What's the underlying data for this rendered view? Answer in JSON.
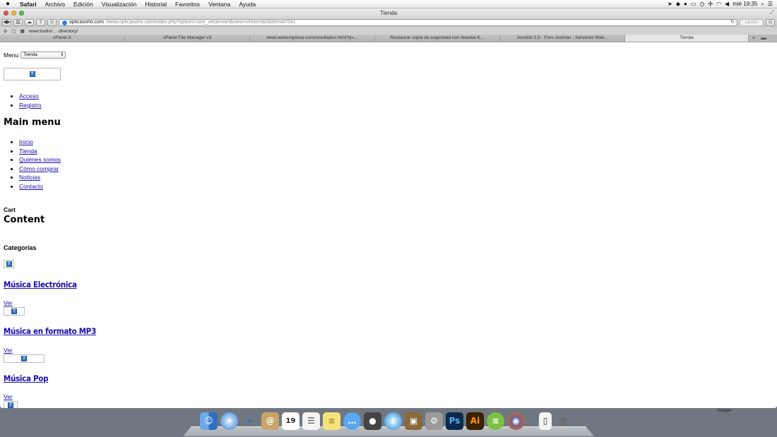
{
  "menubar": {
    "apple": "",
    "app": "Safari",
    "items": [
      "Archivo",
      "Edición",
      "Visualización",
      "Historial",
      "Favoritos",
      "Ventana",
      "Ayuda"
    ],
    "clock": "mié 19:35"
  },
  "window": {
    "title": "Tienda"
  },
  "toolbar": {
    "url_host": "opticasoho.com",
    "url_path": "/www.opticasoho.com/index.php?option=com_virtuemart&view=virtuemart&Itemid=541",
    "reader": "Lector"
  },
  "bookmarks": {
    "item1": "www.tooltor....-directory/"
  },
  "tabs": [
    "cPanel X",
    "cPanel File Manager v3",
    "www.webempresa.com/resultados.html?q=...",
    "Restaurar copia de seguridad con Akeeba K...",
    "Joomla! 2.5 - Foro Joomla! - Servicios Web...",
    "Tienda"
  ],
  "page": {
    "menu_label": "Menu",
    "menu_select": "Tienda",
    "user_links": [
      "Acceso",
      "Registro"
    ],
    "main_menu_title": "Main menu",
    "main_menu": [
      "Inicio",
      "Tienda",
      "Quiénes somos",
      "Cómo comprar",
      "Noticias",
      "Contacto"
    ],
    "cart_title": "Cart",
    "content_title": "Content",
    "categories_title": "Categorías",
    "categories": [
      {
        "name": "Música Electrónica",
        "ver": "Ver"
      },
      {
        "name": "Música en formato MP3",
        "ver": "Ver"
      },
      {
        "name": "Música Pop",
        "ver": "Ver"
      }
    ]
  },
  "dock": {
    "icons": [
      "finder-icon",
      "safari-icon",
      "mail-icon",
      "contacts-icon",
      "calendar-icon",
      "reminders-icon",
      "notes-icon",
      "messages-icon",
      "facetime-icon",
      "itunes-icon",
      "preview-icon",
      "system-preferences-icon",
      "photoshop-icon",
      "illustrator-icon",
      "spotify-icon",
      "firefox-icon",
      "documents-icon",
      "trash-icon"
    ],
    "calendar_day": "19",
    "ps": "Ps",
    "ai": "Ai"
  },
  "desktop": {
    "label": "imagen"
  }
}
